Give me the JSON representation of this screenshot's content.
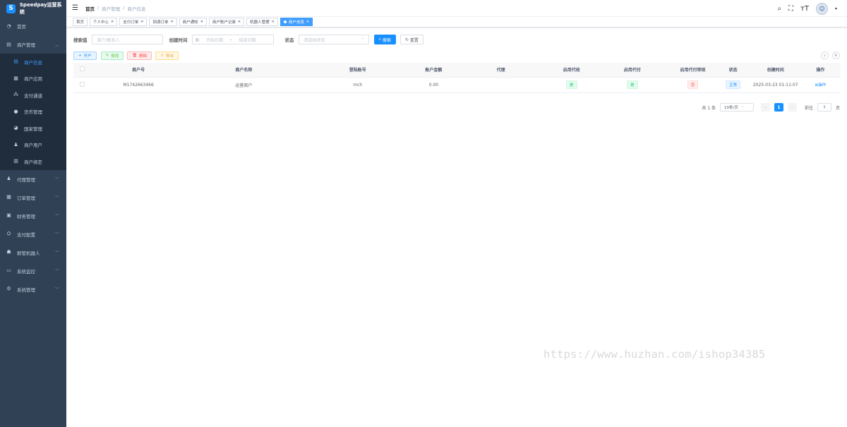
{
  "app": {
    "title": "Speedpay运营系统",
    "logo_glyph": "S"
  },
  "sidebar": {
    "items": [
      {
        "label": "首页",
        "icon": "dashboard-icon",
        "glyph": "◔"
      },
      {
        "label": "商户管理",
        "icon": "merchant-icon",
        "glyph": "▤",
        "expanded": true
      },
      {
        "label": "代理管理",
        "icon": "agent-icon",
        "glyph": "♟"
      },
      {
        "label": "订单管理",
        "icon": "order-icon",
        "glyph": "▦"
      },
      {
        "label": "财务管理",
        "icon": "finance-icon",
        "glyph": "▣"
      },
      {
        "label": "支付配置",
        "icon": "pay-config-icon",
        "glyph": "⛭"
      },
      {
        "label": "群管机器人",
        "icon": "robot-icon",
        "glyph": "☗"
      },
      {
        "label": "系统监控",
        "icon": "monitor-icon",
        "glyph": "▭"
      },
      {
        "label": "系统管理",
        "icon": "system-icon",
        "glyph": "⚙"
      }
    ],
    "submenu": [
      {
        "label": "商户信息",
        "icon": "merchant-info-icon",
        "glyph": "▤",
        "active": true
      },
      {
        "label": "商户应用",
        "icon": "app-icon",
        "glyph": "▦"
      },
      {
        "label": "支付通道",
        "icon": "channel-icon",
        "glyph": "⁂"
      },
      {
        "label": "货币管理",
        "icon": "currency-icon",
        "glyph": "●"
      },
      {
        "label": "国家管理",
        "icon": "country-icon",
        "glyph": "◕"
      },
      {
        "label": "商户用户",
        "icon": "user-icon",
        "glyph": "♟"
      },
      {
        "label": "商户绑定",
        "icon": "bind-icon",
        "glyph": "▥"
      }
    ]
  },
  "navbar": {
    "breadcrumb": [
      "首页",
      "/",
      "商户管理",
      "/",
      "商户信息"
    ],
    "avatar_glyph": "☺"
  },
  "tags": [
    {
      "label": "首页",
      "closable": false,
      "active": false
    },
    {
      "label": "个人中心",
      "closable": true,
      "active": false
    },
    {
      "label": "支付订单",
      "closable": true,
      "active": false
    },
    {
      "label": "回调订单",
      "closable": true,
      "active": false
    },
    {
      "label": "商户通知",
      "closable": true,
      "active": false
    },
    {
      "label": "商户账户记录",
      "closable": true,
      "active": false
    },
    {
      "label": "机器人管理",
      "closable": true,
      "active": false
    },
    {
      "label": "商户信息",
      "closable": true,
      "active": true
    }
  ],
  "search": {
    "keyword_label": "搜索值",
    "keyword_placeholder": "商户/联系人",
    "date_label": "创建时间",
    "date_start": "开始日期",
    "date_sep": "-",
    "date_end": "结束日期",
    "status_label": "状态",
    "status_placeholder": "请选择状态",
    "search_btn": "搜索",
    "reset_btn": "重置"
  },
  "actions": {
    "add": "开户",
    "edit": "修改",
    "delete": "删除",
    "export": "导出"
  },
  "table": {
    "headers": [
      "商户号",
      "商户名称",
      "登陆账号",
      "账户金额",
      "代理",
      "启用代收",
      "启用代付",
      "启用代付审核",
      "状态",
      "创建时间",
      "操作"
    ],
    "rows": [
      {
        "mch_no": "M1742663466",
        "name": "运营商户",
        "login": "mch",
        "amount": "0.00",
        "agent": "",
        "collect": "是",
        "payout": "是",
        "payout_review": "否",
        "status": "正常",
        "created": "2025-03-23 01:11:07",
        "op": "操作"
      }
    ]
  },
  "pager": {
    "total": "共 1 条",
    "size": "10条/页",
    "current": "1",
    "goto": "前往",
    "goto_value": "1",
    "page_unit": "页"
  },
  "watermark": "https://www.huzhan.com/ishop34385"
}
